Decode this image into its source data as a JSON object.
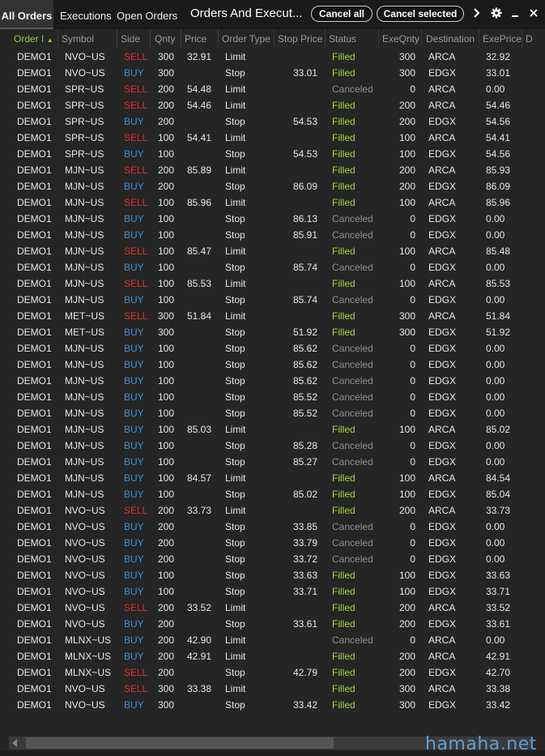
{
  "tabs": [
    {
      "label": "All Orders",
      "active": true
    },
    {
      "label": "Executions",
      "active": false
    },
    {
      "label": "Open Orders",
      "active": false
    }
  ],
  "window_title": "Orders And Execut...",
  "buttons": {
    "cancel_all": "Cancel all",
    "cancel_selected": "Cancel selected"
  },
  "icons": {
    "next": "chevron-right-icon",
    "settings": "gear-icon",
    "minimize": "minimize-icon",
    "close": "close-icon"
  },
  "columns": [
    {
      "key": "order_id",
      "label": "Order I",
      "sorted": true
    },
    {
      "key": "symbol",
      "label": "Symbol"
    },
    {
      "key": "side",
      "label": "Side"
    },
    {
      "key": "qnty",
      "label": "Qnty"
    },
    {
      "key": "price",
      "label": "Price"
    },
    {
      "key": "order_type",
      "label": "Order Type"
    },
    {
      "key": "stop_price",
      "label": "Stop Price"
    },
    {
      "key": "status",
      "label": "Status"
    },
    {
      "key": "exe_qnty",
      "label": "ExeQnty"
    },
    {
      "key": "destination",
      "label": "Destination"
    },
    {
      "key": "exe_price",
      "label": "ExePrice"
    },
    {
      "key": "d",
      "label": "D"
    }
  ],
  "rows": [
    [
      "DEMO1",
      "NVO~US",
      "SELL",
      "300",
      "32.91",
      "Limit",
      "",
      "Filled",
      "300",
      "ARCA",
      "32.92"
    ],
    [
      "DEMO1",
      "NVO~US",
      "BUY",
      "300",
      "",
      "Stop",
      "33.01",
      "Filled",
      "300",
      "EDGX",
      "33.01"
    ],
    [
      "DEMO1",
      "SPR~US",
      "SELL",
      "200",
      "54.48",
      "Limit",
      "",
      "Canceled",
      "0",
      "ARCA",
      "0.00"
    ],
    [
      "DEMO1",
      "SPR~US",
      "SELL",
      "200",
      "54.46",
      "Limit",
      "",
      "Filled",
      "200",
      "ARCA",
      "54.46"
    ],
    [
      "DEMO1",
      "SPR~US",
      "BUY",
      "200",
      "",
      "Stop",
      "54.53",
      "Filled",
      "200",
      "EDGX",
      "54.56"
    ],
    [
      "DEMO1",
      "SPR~US",
      "SELL",
      "100",
      "54.41",
      "Limit",
      "",
      "Filled",
      "100",
      "ARCA",
      "54.41"
    ],
    [
      "DEMO1",
      "SPR~US",
      "BUY",
      "100",
      "",
      "Stop",
      "54.53",
      "Filled",
      "100",
      "EDGX",
      "54.56"
    ],
    [
      "DEMO1",
      "MJN~US",
      "SELL",
      "200",
      "85.89",
      "Limit",
      "",
      "Filled",
      "200",
      "ARCA",
      "85.93"
    ],
    [
      "DEMO1",
      "MJN~US",
      "BUY",
      "200",
      "",
      "Stop",
      "86.09",
      "Filled",
      "200",
      "EDGX",
      "86.09"
    ],
    [
      "DEMO1",
      "MJN~US",
      "SELL",
      "100",
      "85.96",
      "Limit",
      "",
      "Filled",
      "100",
      "ARCA",
      "85.96"
    ],
    [
      "DEMO1",
      "MJN~US",
      "BUY",
      "100",
      "",
      "Stop",
      "86.13",
      "Canceled",
      "0",
      "EDGX",
      "0.00"
    ],
    [
      "DEMO1",
      "MJN~US",
      "BUY",
      "100",
      "",
      "Stop",
      "85.91",
      "Canceled",
      "0",
      "EDGX",
      "0.00"
    ],
    [
      "DEMO1",
      "MJN~US",
      "SELL",
      "100",
      "85.47",
      "Limit",
      "",
      "Filled",
      "100",
      "ARCA",
      "85.48"
    ],
    [
      "DEMO1",
      "MJN~US",
      "BUY",
      "100",
      "",
      "Stop",
      "85.74",
      "Canceled",
      "0",
      "EDGX",
      "0.00"
    ],
    [
      "DEMO1",
      "MJN~US",
      "SELL",
      "100",
      "85.53",
      "Limit",
      "",
      "Filled",
      "100",
      "ARCA",
      "85.53"
    ],
    [
      "DEMO1",
      "MJN~US",
      "BUY",
      "100",
      "",
      "Stop",
      "85.74",
      "Canceled",
      "0",
      "EDGX",
      "0.00"
    ],
    [
      "DEMO1",
      "MET~US",
      "SELL",
      "300",
      "51.84",
      "Limit",
      "",
      "Filled",
      "300",
      "ARCA",
      "51.84"
    ],
    [
      "DEMO1",
      "MET~US",
      "BUY",
      "300",
      "",
      "Stop",
      "51.92",
      "Filled",
      "300",
      "EDGX",
      "51.92"
    ],
    [
      "DEMO1",
      "MJN~US",
      "BUY",
      "100",
      "",
      "Stop",
      "85.62",
      "Canceled",
      "0",
      "EDGX",
      "0.00"
    ],
    [
      "DEMO1",
      "MJN~US",
      "BUY",
      "100",
      "",
      "Stop",
      "85.62",
      "Canceled",
      "0",
      "EDGX",
      "0.00"
    ],
    [
      "DEMO1",
      "MJN~US",
      "BUY",
      "100",
      "",
      "Stop",
      "85.62",
      "Canceled",
      "0",
      "EDGX",
      "0.00"
    ],
    [
      "DEMO1",
      "MJN~US",
      "BUY",
      "100",
      "",
      "Stop",
      "85.52",
      "Canceled",
      "0",
      "EDGX",
      "0.00"
    ],
    [
      "DEMO1",
      "MJN~US",
      "BUY",
      "100",
      "",
      "Stop",
      "85.52",
      "Canceled",
      "0",
      "EDGX",
      "0.00"
    ],
    [
      "DEMO1",
      "MJN~US",
      "BUY",
      "100",
      "85.03",
      "Limit",
      "",
      "Filled",
      "100",
      "ARCA",
      "85.02"
    ],
    [
      "DEMO1",
      "MJN~US",
      "BUY",
      "100",
      "",
      "Stop",
      "85.28",
      "Canceled",
      "0",
      "EDGX",
      "0.00"
    ],
    [
      "DEMO1",
      "MJN~US",
      "BUY",
      "100",
      "",
      "Stop",
      "85.27",
      "Canceled",
      "0",
      "EDGX",
      "0.00"
    ],
    [
      "DEMO1",
      "MJN~US",
      "BUY",
      "100",
      "84.57",
      "Limit",
      "",
      "Filled",
      "100",
      "ARCA",
      "84.54"
    ],
    [
      "DEMO1",
      "MJN~US",
      "BUY",
      "100",
      "",
      "Stop",
      "85.02",
      "Filled",
      "100",
      "EDGX",
      "85.04"
    ],
    [
      "DEMO1",
      "NVO~US",
      "SELL",
      "200",
      "33.73",
      "Limit",
      "",
      "Filled",
      "200",
      "ARCA",
      "33.73"
    ],
    [
      "DEMO1",
      "NVO~US",
      "BUY",
      "200",
      "",
      "Stop",
      "33.85",
      "Canceled",
      "0",
      "EDGX",
      "0.00"
    ],
    [
      "DEMO1",
      "NVO~US",
      "BUY",
      "200",
      "",
      "Stop",
      "33.79",
      "Canceled",
      "0",
      "EDGX",
      "0.00"
    ],
    [
      "DEMO1",
      "NVO~US",
      "BUY",
      "200",
      "",
      "Stop",
      "33.72",
      "Canceled",
      "0",
      "EDGX",
      "0.00"
    ],
    [
      "DEMO1",
      "NVO~US",
      "BUY",
      "100",
      "",
      "Stop",
      "33.63",
      "Filled",
      "100",
      "EDGX",
      "33.63"
    ],
    [
      "DEMO1",
      "NVO~US",
      "BUY",
      "100",
      "",
      "Stop",
      "33.71",
      "Filled",
      "100",
      "EDGX",
      "33.71"
    ],
    [
      "DEMO1",
      "NVO~US",
      "SELL",
      "200",
      "33.52",
      "Limit",
      "",
      "Filled",
      "200",
      "ARCA",
      "33.52"
    ],
    [
      "DEMO1",
      "NVO~US",
      "BUY",
      "200",
      "",
      "Stop",
      "33.61",
      "Filled",
      "200",
      "EDGX",
      "33.61"
    ],
    [
      "DEMO1",
      "MLNX~US",
      "BUY",
      "200",
      "42.90",
      "Limit",
      "",
      "Canceled",
      "0",
      "ARCA",
      "0.00"
    ],
    [
      "DEMO1",
      "MLNX~US",
      "BUY",
      "200",
      "42.91",
      "Limit",
      "",
      "Filled",
      "200",
      "ARCA",
      "42.91"
    ],
    [
      "DEMO1",
      "MLNX~US",
      "SELL",
      "200",
      "",
      "Stop",
      "42.79",
      "Filled",
      "200",
      "EDGX",
      "42.70"
    ],
    [
      "DEMO1",
      "NVO~US",
      "SELL",
      "300",
      "33.38",
      "Limit",
      "",
      "Filled",
      "300",
      "ARCA",
      "33.38"
    ],
    [
      "DEMO1",
      "NVO~US",
      "BUY",
      "300",
      "",
      "Stop",
      "33.42",
      "Filled",
      "300",
      "EDGX",
      "33.42"
    ]
  ],
  "watermark": "hamaha.net",
  "colors": {
    "sell": "#d9322c",
    "buy": "#3d8fd8",
    "filled": "#a6d63a",
    "canceled": "#8f8f8f",
    "sorted_header": "#93c94a"
  }
}
